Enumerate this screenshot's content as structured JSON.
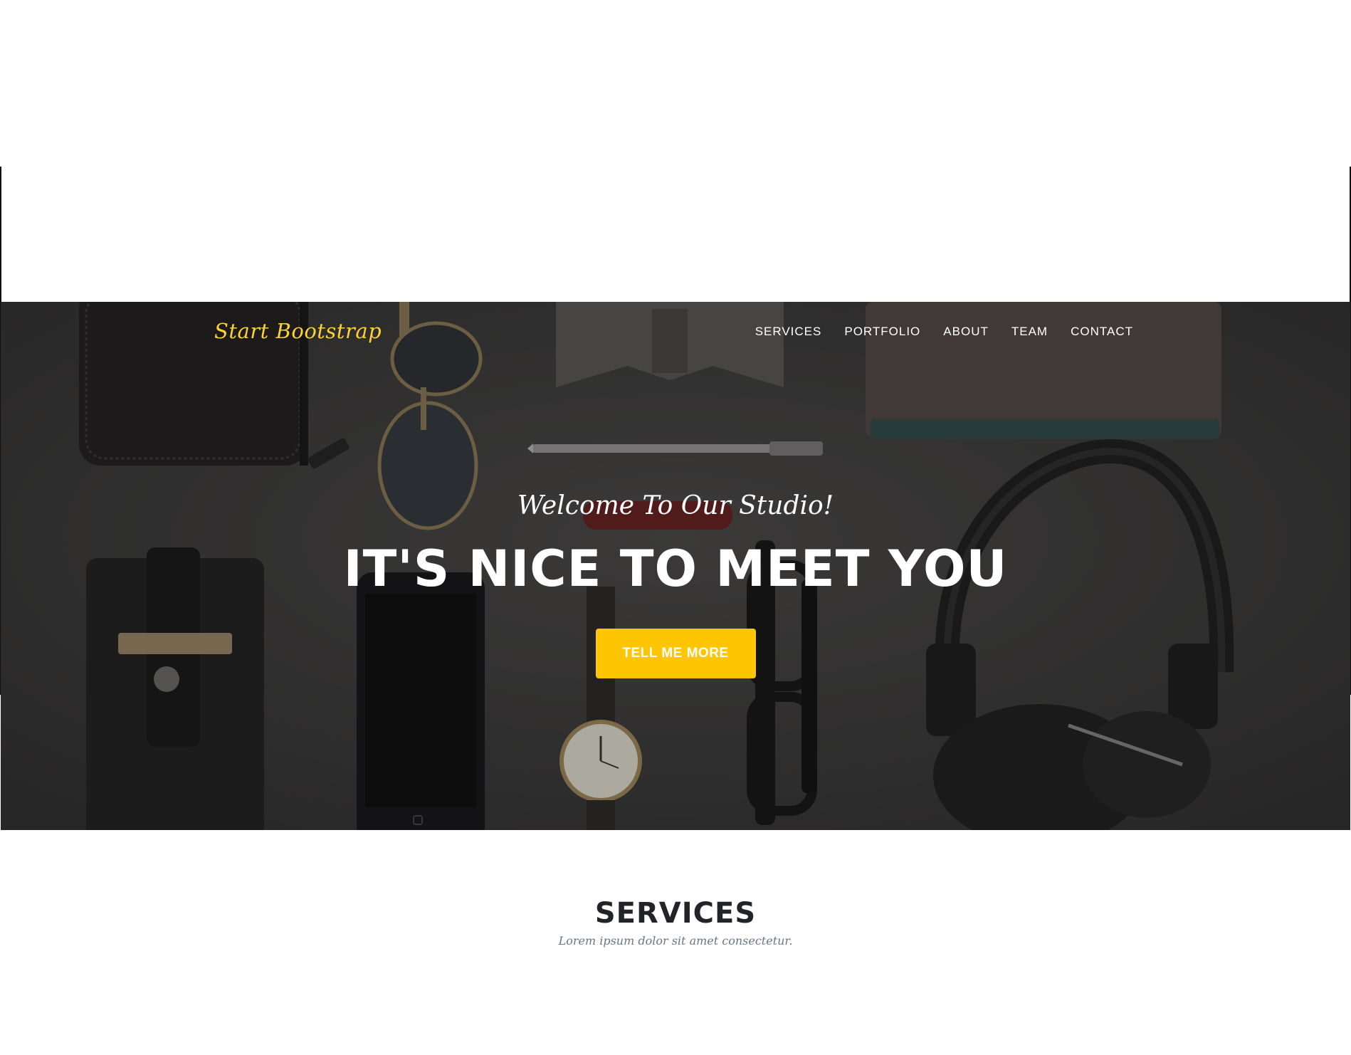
{
  "navbar": {
    "brand": "Start Bootstrap",
    "links": [
      "SERVICES",
      "PORTFOLIO",
      "ABOUT",
      "TEAM",
      "CONTACT"
    ]
  },
  "hero": {
    "lead_in": "Welcome To Our Studio!",
    "heading": "IT'S NICE TO MEET YOU",
    "button": "TELL ME MORE"
  },
  "services": {
    "title": "SERVICES",
    "subtitle": "Lorem ipsum dolor sit amet consectetur."
  },
  "colors": {
    "brand": "#fed136",
    "button": "#fec503",
    "heading_dark": "#212529",
    "muted": "#6c757d"
  }
}
